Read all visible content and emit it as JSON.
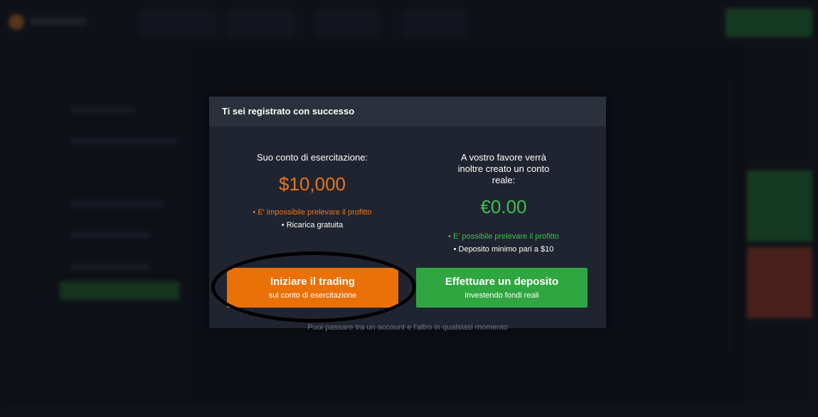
{
  "modal": {
    "title": "Ti sei registrato con successo",
    "practice": {
      "title": "Suo conto di esercitazione:",
      "amount": "$10,000",
      "note1": "• E' impossibile prelevare il profitto",
      "note2": "• Ricarica gratuita",
      "button_title": "Iniziare il trading",
      "button_sub": "sul conto di esercitazione"
    },
    "real": {
      "title": "A vostro favore verrà inoltre creato un conto reale:",
      "amount": "€0.00",
      "note1": "• E' possibile prelevare il profitto",
      "note2": "• Deposito minimo pari a  $10",
      "button_title": "Effettuare un deposito",
      "button_sub": "investendo fondi reali"
    },
    "footer": "Puoi passare tra un account e l'altro in qualsiasi momento"
  },
  "colors": {
    "practice_accent": "#ea7008",
    "real_accent": "#2fa640",
    "modal_bg": "#1f2430",
    "annotation_circle": "#000000"
  }
}
